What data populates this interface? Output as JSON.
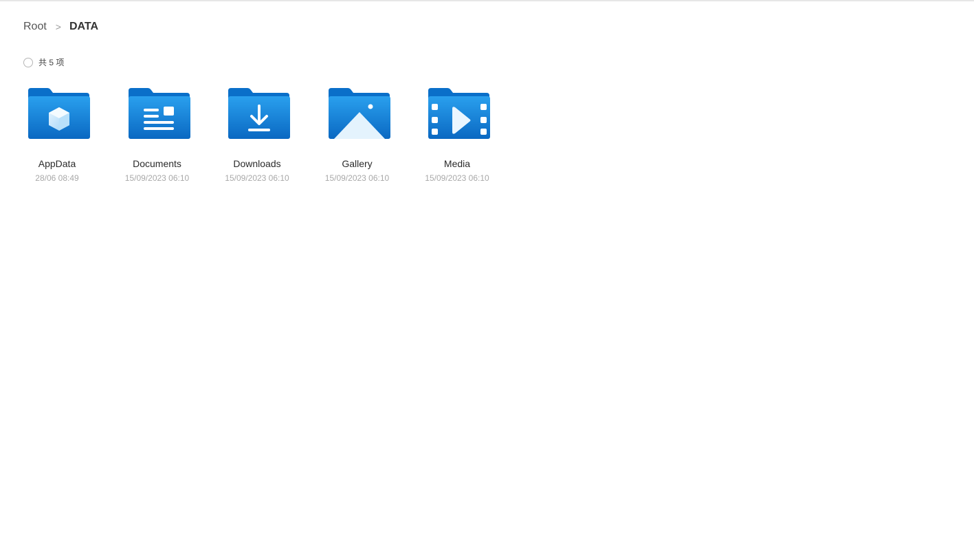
{
  "breadcrumb": {
    "root": "Root",
    "separator": ">",
    "current": "DATA"
  },
  "selection": {
    "count_label": "共 5 项"
  },
  "colors": {
    "folder_back": "#0a6fc9",
    "folder_front_top": "#2a9bec",
    "folder_front_bottom": "#0b6cc6",
    "name_text": "#2a2a2a",
    "date_text": "#a8a8a8"
  },
  "folders": [
    {
      "name": "AppData",
      "date": "28/06 08:49",
      "icon": "cube-folder-icon"
    },
    {
      "name": "Documents",
      "date": "15/09/2023 06:10",
      "icon": "document-folder-icon"
    },
    {
      "name": "Downloads",
      "date": "15/09/2023 06:10",
      "icon": "download-folder-icon"
    },
    {
      "name": "Gallery",
      "date": "15/09/2023 06:10",
      "icon": "image-folder-icon"
    },
    {
      "name": "Media",
      "date": "15/09/2023 06:10",
      "icon": "video-folder-icon"
    }
  ]
}
